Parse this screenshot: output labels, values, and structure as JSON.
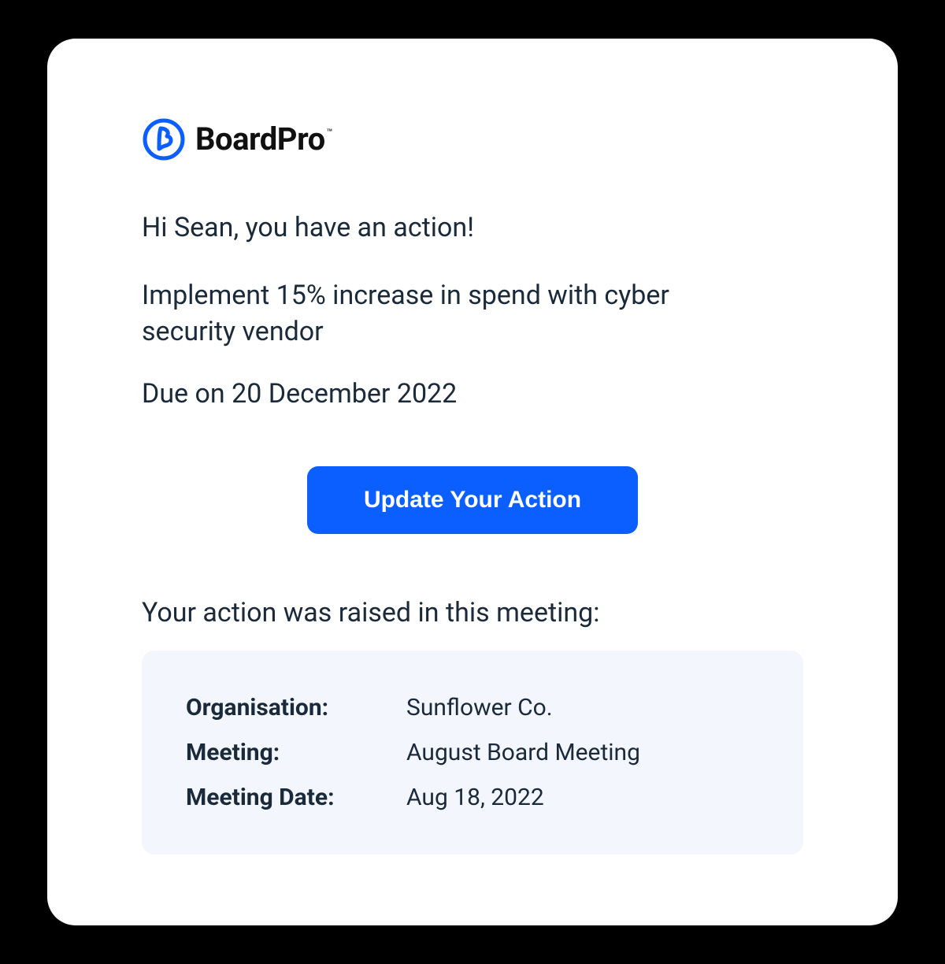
{
  "brand": {
    "name": "BoardPro",
    "tm": "™",
    "accent": "#0b5fff"
  },
  "greeting": "Hi Sean, you have an action!",
  "action_title": "Implement 15% increase in spend with cyber security vendor",
  "due_line": "Due on 20 December 2022",
  "cta_label": "Update Your Action",
  "raised_label": "Your action was raised in this meeting:",
  "meeting": {
    "org_label": "Organisation:",
    "org_value": "Sunflower Co.",
    "meeting_label": "Meeting:",
    "meeting_value": "August Board Meeting",
    "date_label": "Meeting Date:",
    "date_value": "Aug 18, 2022"
  }
}
